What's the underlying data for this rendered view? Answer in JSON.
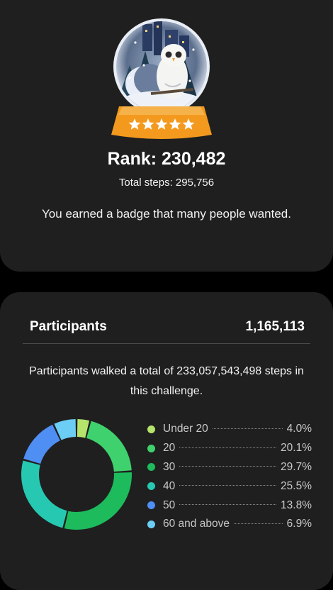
{
  "badge": {
    "rank_text": "Rank: 230,482",
    "total_steps_text": "Total steps: 295,756",
    "message": "You earned a badge that many people wanted.",
    "icon": "snow-globe-owl-badge",
    "stars": 5
  },
  "participants": {
    "title": "Participants",
    "count": "1,165,113",
    "description": "Participants walked a total of 233,057,543,498 steps in this challenge.",
    "legend": [
      {
        "label": "Under 20",
        "value": "4.0%",
        "percent": 4.0,
        "color": "#b5e36b"
      },
      {
        "label": "20",
        "value": "20.1%",
        "percent": 20.1,
        "color": "#3fd16e"
      },
      {
        "label": "30",
        "value": "29.7%",
        "percent": 29.7,
        "color": "#1dbb5c"
      },
      {
        "label": "40",
        "value": "25.5%",
        "percent": 25.5,
        "color": "#26c8b1"
      },
      {
        "label": "50",
        "value": "13.8%",
        "percent": 13.8,
        "color": "#4f8ef2"
      },
      {
        "label": "60 and above",
        "value": "6.9%",
        "percent": 6.9,
        "color": "#6ccdf5"
      }
    ]
  }
}
